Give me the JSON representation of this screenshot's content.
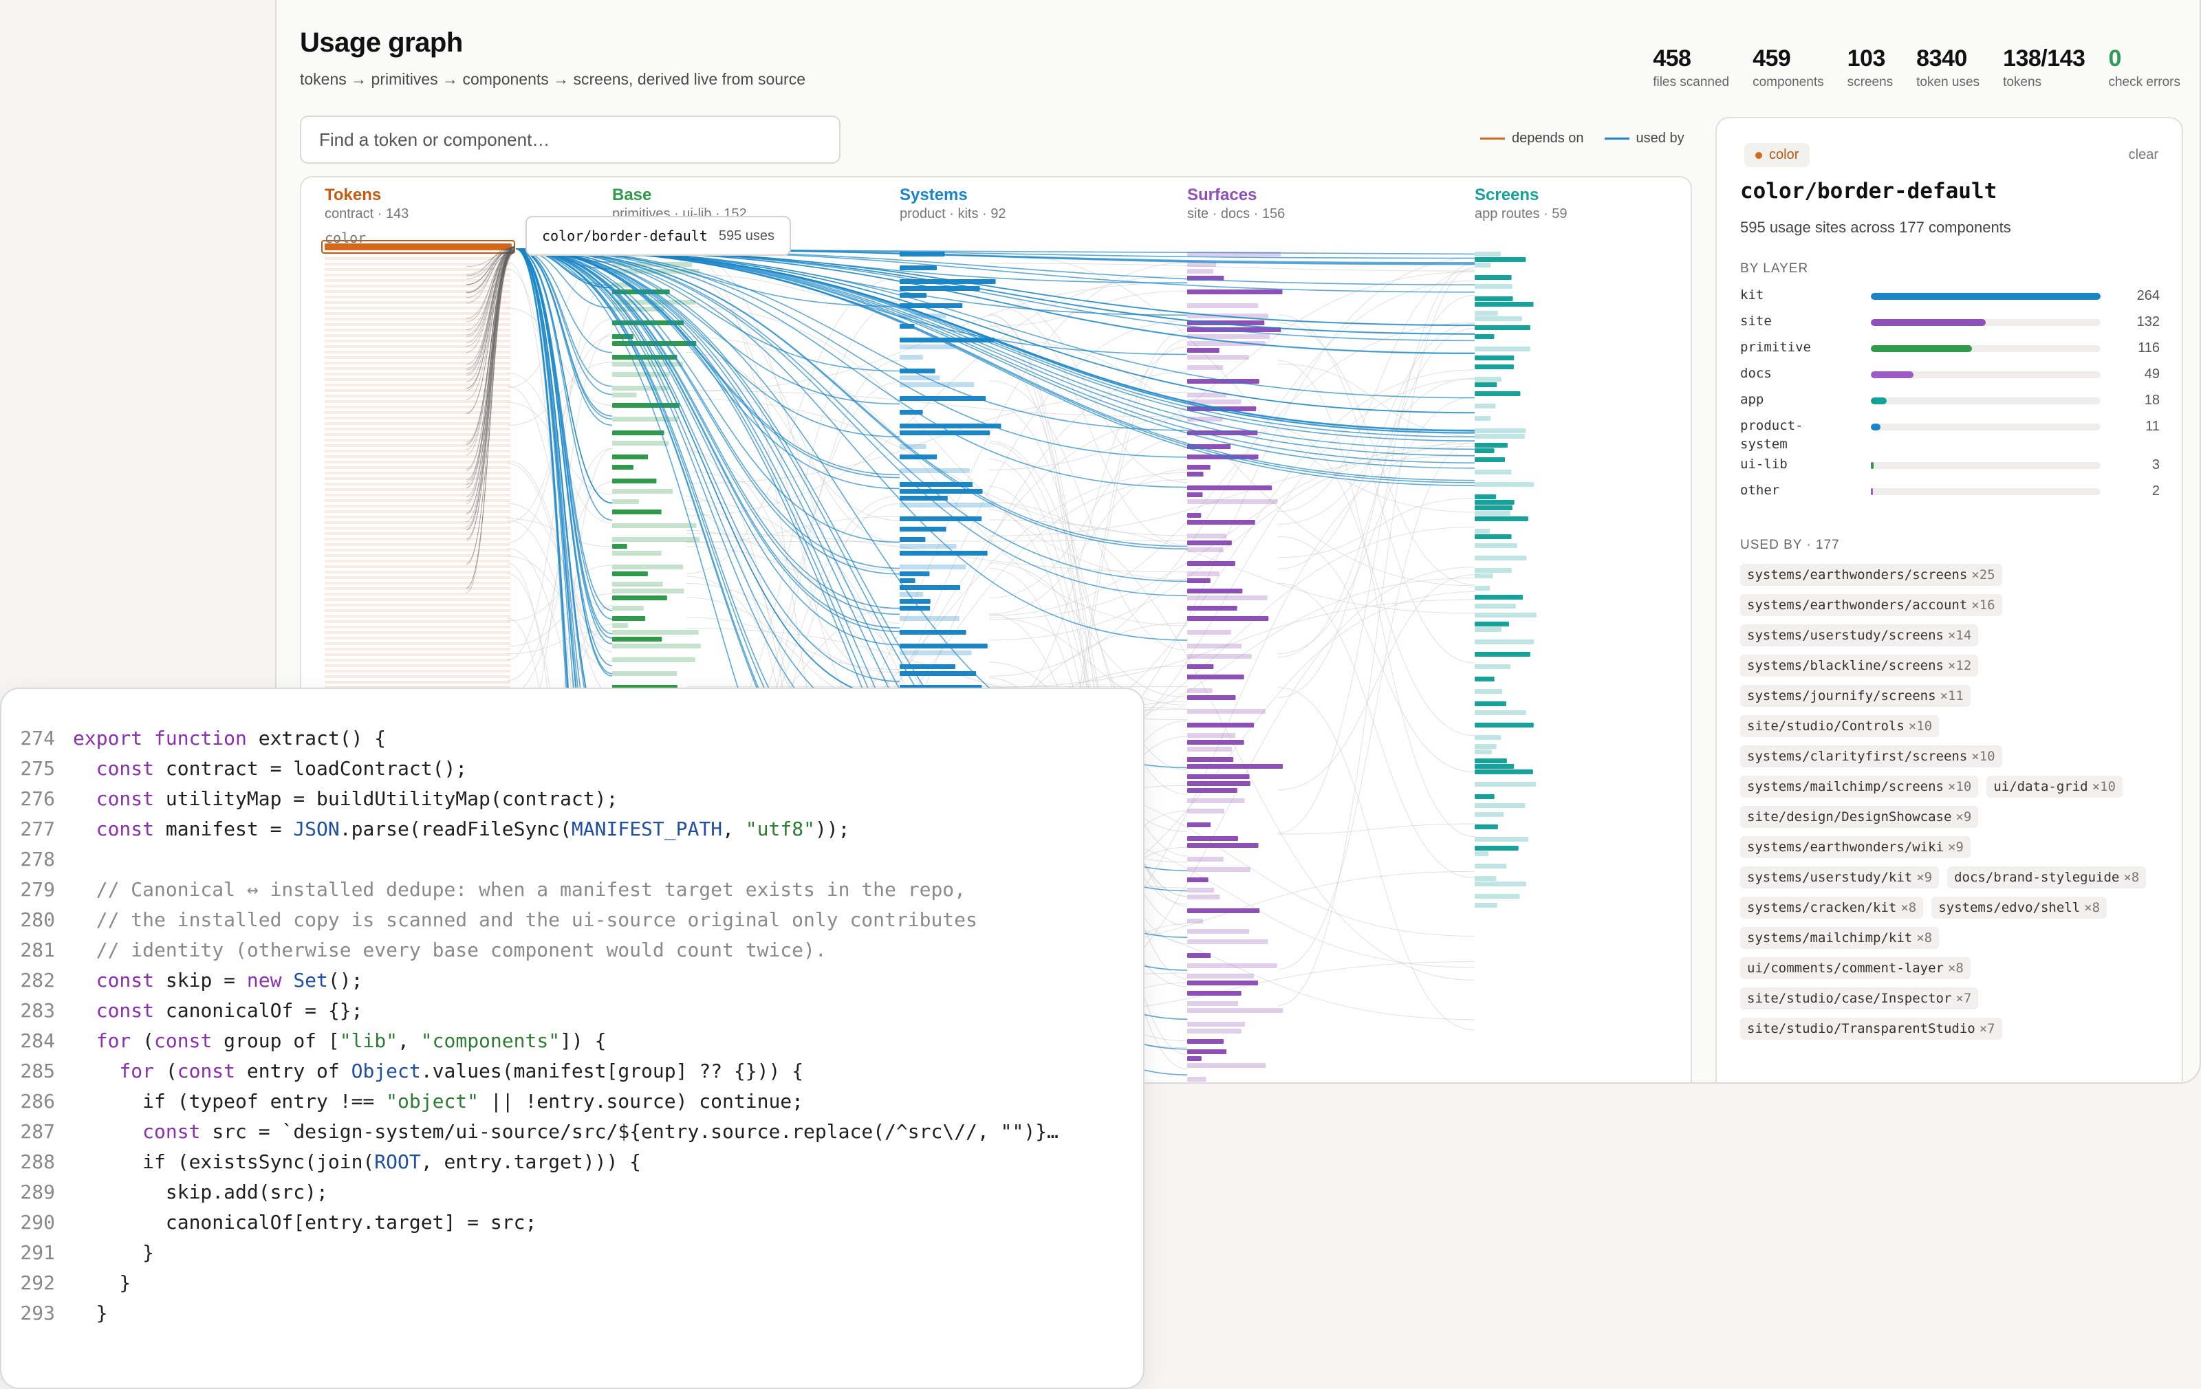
{
  "header": {
    "title": "Usage graph",
    "subtitle": "tokens → primitives → components → screens, derived live from source"
  },
  "stats": [
    {
      "value": "458",
      "label": "files scanned"
    },
    {
      "value": "459",
      "label": "components"
    },
    {
      "value": "103",
      "label": "screens"
    },
    {
      "value": "8340",
      "label": "token uses"
    },
    {
      "value": "138/143",
      "label": "tokens"
    },
    {
      "value": "0",
      "label": "check errors"
    }
  ],
  "search": {
    "placeholder": "Find a token or component…"
  },
  "legend": {
    "depends_on": "depends on",
    "used_by": "used by",
    "depends_on_color": "#d4691b",
    "used_by_color": "#1a86c8"
  },
  "graph": {
    "columns": [
      {
        "name": "Tokens",
        "meta": "contract · 143",
        "color": "#c65a13"
      },
      {
        "name": "Base",
        "meta": "primitives · ui-lib · 152",
        "color": "#2f9a49"
      },
      {
        "name": "Systems",
        "meta": "product · kits · 92",
        "color": "#1a86c8"
      },
      {
        "name": "Surfaces",
        "meta": "site · docs · 156",
        "color": "#8e4fb8"
      },
      {
        "name": "Screens",
        "meta": "app routes · 59",
        "color": "#15a29a"
      }
    ],
    "token_group_label": "color",
    "tooltip": {
      "name": "color/border-default",
      "uses": "595 uses"
    }
  },
  "panel": {
    "chip": "color",
    "clear": "clear",
    "name": "color/border-default",
    "description": "595 usage sites across 177 components",
    "by_layer_heading": "BY LAYER",
    "max_count": 264,
    "layers": [
      {
        "name": "kit",
        "count": 264,
        "color": "#1a86c8"
      },
      {
        "name": "site",
        "count": 132,
        "color": "#8e4fb8"
      },
      {
        "name": "primitive",
        "count": 116,
        "color": "#2f9a49"
      },
      {
        "name": "docs",
        "count": 49,
        "color": "#9d5bc6"
      },
      {
        "name": "app",
        "count": 18,
        "color": "#15a29a"
      },
      {
        "name": "product-\nsystem",
        "count": 11,
        "color": "#1a86c8"
      },
      {
        "name": "ui-lib",
        "count": 3,
        "color": "#2f9a49"
      },
      {
        "name": "other",
        "count": 2,
        "color": "#9d5bc6"
      }
    ],
    "used_by_heading": "USED BY · 177",
    "used_by": [
      {
        "name": "systems/earthwonders/screens",
        "count": "×25"
      },
      {
        "name": "systems/earthwonders/account",
        "count": "×16"
      },
      {
        "name": "systems/userstudy/screens",
        "count": "×14"
      },
      {
        "name": "systems/blackline/screens",
        "count": "×12"
      },
      {
        "name": "systems/journify/screens",
        "count": "×11"
      },
      {
        "name": "site/studio/Controls",
        "count": "×10"
      },
      {
        "name": "systems/clarityfirst/screens",
        "count": "×10"
      },
      {
        "name": "systems/mailchimp/screens",
        "count": "×10"
      },
      {
        "name": "ui/data-grid",
        "count": "×10"
      },
      {
        "name": "site/design/DesignShowcase",
        "count": "×9"
      },
      {
        "name": "systems/earthwonders/wiki",
        "count": "×9"
      },
      {
        "name": "systems/userstudy/kit",
        "count": "×9"
      },
      {
        "name": "docs/brand-styleguide",
        "count": "×8"
      },
      {
        "name": "systems/cracken/kit",
        "count": "×8"
      },
      {
        "name": "systems/edvo/shell",
        "count": "×8"
      },
      {
        "name": "systems/mailchimp/kit",
        "count": "×8"
      },
      {
        "name": "ui/comments/comment-layer",
        "count": "×8"
      },
      {
        "name": "site/studio/case/Inspector",
        "count": "×7"
      },
      {
        "name": "site/studio/TransparentStudio",
        "count": "×7"
      }
    ]
  },
  "code": {
    "lines": [
      {
        "n": "274",
        "t": [
          [
            "k",
            "export function "
          ],
          [
            "p",
            "extract() {"
          ]
        ]
      },
      {
        "n": "275",
        "t": [
          [
            "p",
            "  "
          ],
          [
            "k",
            "const "
          ],
          [
            "p",
            "contract = loadContract();"
          ]
        ]
      },
      {
        "n": "276",
        "t": [
          [
            "p",
            "  "
          ],
          [
            "k",
            "const "
          ],
          [
            "p",
            "utilityMap = buildUtilityMap(contract);"
          ]
        ]
      },
      {
        "n": "277",
        "t": [
          [
            "p",
            "  "
          ],
          [
            "k",
            "const "
          ],
          [
            "p",
            "manifest = "
          ],
          [
            "b",
            "JSON"
          ],
          [
            "p",
            ".parse(readFileSync("
          ],
          [
            "b",
            "MANIFEST_PATH"
          ],
          [
            "p",
            ", "
          ],
          [
            "s",
            "\"utf8\""
          ],
          [
            "p",
            "));"
          ]
        ]
      },
      {
        "n": "278",
        "t": []
      },
      {
        "n": "279",
        "t": [
          [
            "c",
            "  // Canonical ↔ installed dedupe: when a manifest target exists in the repo,"
          ]
        ]
      },
      {
        "n": "280",
        "t": [
          [
            "c",
            "  // the installed copy is scanned and the ui-source original only contributes"
          ]
        ]
      },
      {
        "n": "281",
        "t": [
          [
            "c",
            "  // identity (otherwise every base component would count twice)."
          ]
        ]
      },
      {
        "n": "282",
        "t": [
          [
            "p",
            "  "
          ],
          [
            "k",
            "const "
          ],
          [
            "p",
            "skip = "
          ],
          [
            "k",
            "new "
          ],
          [
            "b",
            "Set"
          ],
          [
            "p",
            "();"
          ]
        ]
      },
      {
        "n": "283",
        "t": [
          [
            "p",
            "  "
          ],
          [
            "k",
            "const "
          ],
          [
            "p",
            "canonicalOf = {};"
          ]
        ]
      },
      {
        "n": "284",
        "t": [
          [
            "p",
            "  "
          ],
          [
            "k",
            "for "
          ],
          [
            "p",
            "("
          ],
          [
            "k",
            "const "
          ],
          [
            "p",
            "group of ["
          ],
          [
            "s",
            "\"lib\""
          ],
          [
            "p",
            ", "
          ],
          [
            "s",
            "\"components\""
          ],
          [
            "p",
            "]) {"
          ]
        ]
      },
      {
        "n": "285",
        "t": [
          [
            "p",
            "    "
          ],
          [
            "k",
            "for "
          ],
          [
            "p",
            "("
          ],
          [
            "k",
            "const "
          ],
          [
            "p",
            "entry of "
          ],
          [
            "b",
            "Object"
          ],
          [
            "p",
            ".values(manifest[group] ?? {})) {"
          ]
        ]
      },
      {
        "n": "286",
        "t": [
          [
            "p",
            "      if (typeof entry !== "
          ],
          [
            "s",
            "\"object\""
          ],
          [
            "p",
            " || !entry.source) continue;"
          ]
        ]
      },
      {
        "n": "287",
        "t": [
          [
            "p",
            "      "
          ],
          [
            "k",
            "const "
          ],
          [
            "p",
            "src = `design-system/ui-source/src/${entry.source.replace(/^src\\//, \"\")}…"
          ]
        ]
      },
      {
        "n": "288",
        "t": [
          [
            "p",
            "      if (existsSync(join("
          ],
          [
            "b",
            "ROOT"
          ],
          [
            "p",
            ", entry.target))) {"
          ]
        ]
      },
      {
        "n": "289",
        "t": [
          [
            "p",
            "        skip.add(src);"
          ]
        ]
      },
      {
        "n": "290",
        "t": [
          [
            "p",
            "        canonicalOf[entry.target] = src;"
          ]
        ]
      },
      {
        "n": "291",
        "t": [
          [
            "p",
            "      }"
          ]
        ]
      },
      {
        "n": "292",
        "t": [
          [
            "p",
            "    }"
          ]
        ]
      },
      {
        "n": "293",
        "t": [
          [
            "p",
            "  }"
          ]
        ]
      }
    ]
  }
}
